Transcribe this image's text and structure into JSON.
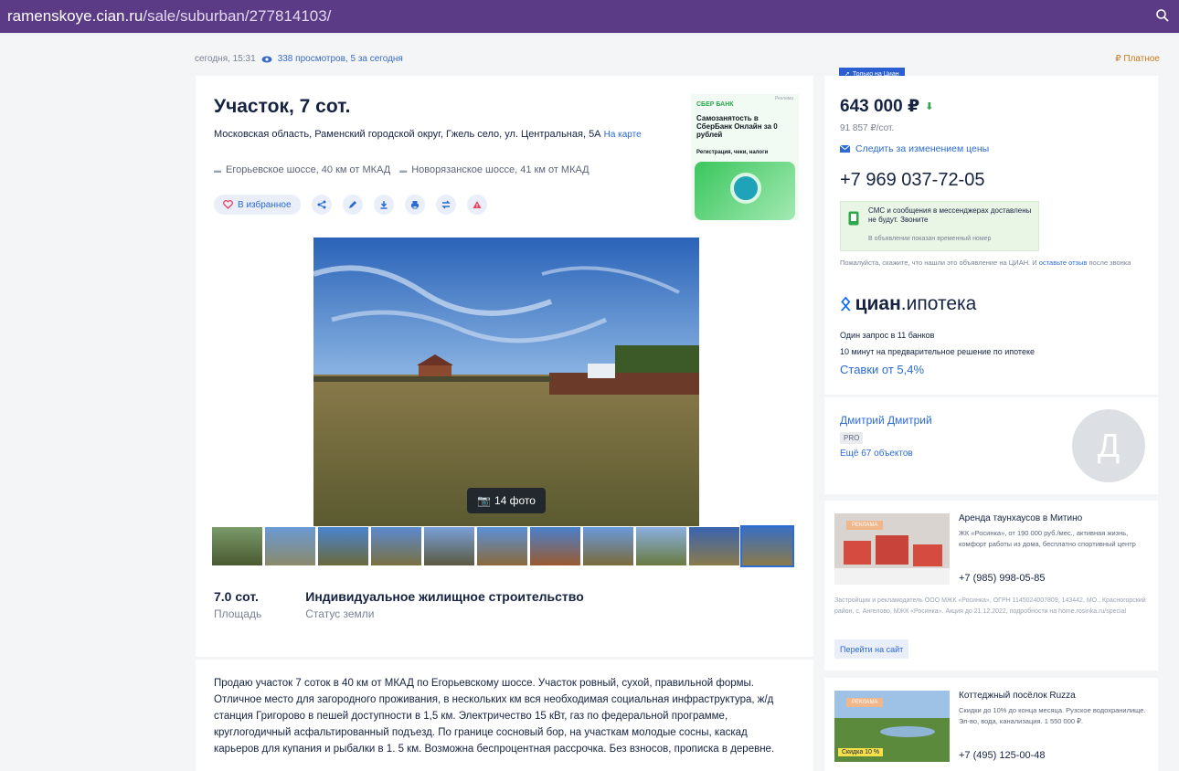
{
  "browser": {
    "url_host": "ramenskoye.cian.ru",
    "url_path": "/sale/suburban/277814103/",
    "search_icon": "search-icon"
  },
  "meta": {
    "date": "сегодня, 15:31",
    "views": "338 просмотров, 5 за сегодня",
    "paid": "₽ Платное"
  },
  "listing": {
    "title": "Участок, 7 сот.",
    "address": "Московская область, Раменский городской округ, Гжель село, ул. Центральная, 5А",
    "map_link": "На карте",
    "highways": [
      {
        "label": "Егорьевское шоссе, 40 км от МКАД"
      },
      {
        "label": "Новорязанское шоссе, 41 км от МКАД"
      }
    ],
    "favorite_label": "В избранное",
    "photo_count": "14 фото",
    "facts": [
      {
        "value": "7.0 сот.",
        "label": "Площадь"
      },
      {
        "value": "Индивидуальное жилищное строительство",
        "label": "Статус земли"
      }
    ],
    "description": "Продаю участок  7  соток в 40 км от МКАД по Егорьевскому шоссе. Участок ровный, сухой, правильной формы. Отличное место для загородного проживания, в нескольких км вся необходимая социальная инфраструктура, ж/д станция Григорово в пешей доступности в 1,5 км. Электричество 15 кВт, газ  по федеральной программе, круглогодичный асфальтированный подъезд. По границе сосновый бор, на участкам молодые сосны, каскад карьеров для купания и рыбалки в 1. 5 км.  Возможна беспроцентная рассрочка. Без взносов, прописка в деревне."
  },
  "sber_ad": {
    "brand": "СБЕР БАНК",
    "tiny": "Реклама",
    "text": "Самозанятость в СберБанк Онлайн за 0 рублей",
    "sub": "Регистрация, чеки, налоги"
  },
  "sidebar": {
    "only_badge": "Только на Циан",
    "price": "643 000 ₽",
    "per_sot": "91 857 ₽/сот.",
    "follow_price": "Следить за изменением цены",
    "phone": "+7 969 037-72-05",
    "sms_note": "СМС и сообщения в мессенджерах доставлены не будут. Звоните",
    "sms_temp": "В объявлении показан временный номер",
    "please_prefix": "Пожалуйста, скажите, что нашли это объявление на ЦИАН. И",
    "please_link": "оставьте отзыв",
    "please_suffix": "после звонка",
    "mortgage_brand_a": "циан",
    "mortgage_brand_b": ".ипотека",
    "mortgage_line1": "Один запрос в 11 банков",
    "mortgage_line2": "10 минут на предварительное решение по ипотеке",
    "rates": "Ставки от 5,4%",
    "agent_name": "Дмитрий Дмитрий",
    "agent_badge": "PRO",
    "agent_more": "Ещё 67 объектов",
    "agent_initial": "Д"
  },
  "ads": [
    {
      "tag": "РЕКЛАМА",
      "title": "Аренда таунхаусов в Митино",
      "text": "ЖК «Росинка», от 190 000 руб./мес., активная жизнь, комфорт работы из дома, бесплатно спортивный центр",
      "phone": "+7 (985) 998-05-85",
      "legal": "Застройщик и рекламодатель ООО МЖК «Росинка», ОГРН 1145024007809, 143442, МО., Красногорский район, с. Ангелово, МЖК «Росинка». Акция до 21.12.2022, подробности на home.rosinka.ru/special",
      "button": "Перейти на сайт"
    },
    {
      "tag": "РЕКЛАМА",
      "title": "Коттеджный посёлок Ruzza",
      "text": "Скидки до 10% до конца месяца. Рузское водохранилище. Эл-во, вода, канализация. 1 550 000 ₽.",
      "phone": "+7 (495) 125-00-48",
      "discount": "Скидка 10 %"
    }
  ]
}
